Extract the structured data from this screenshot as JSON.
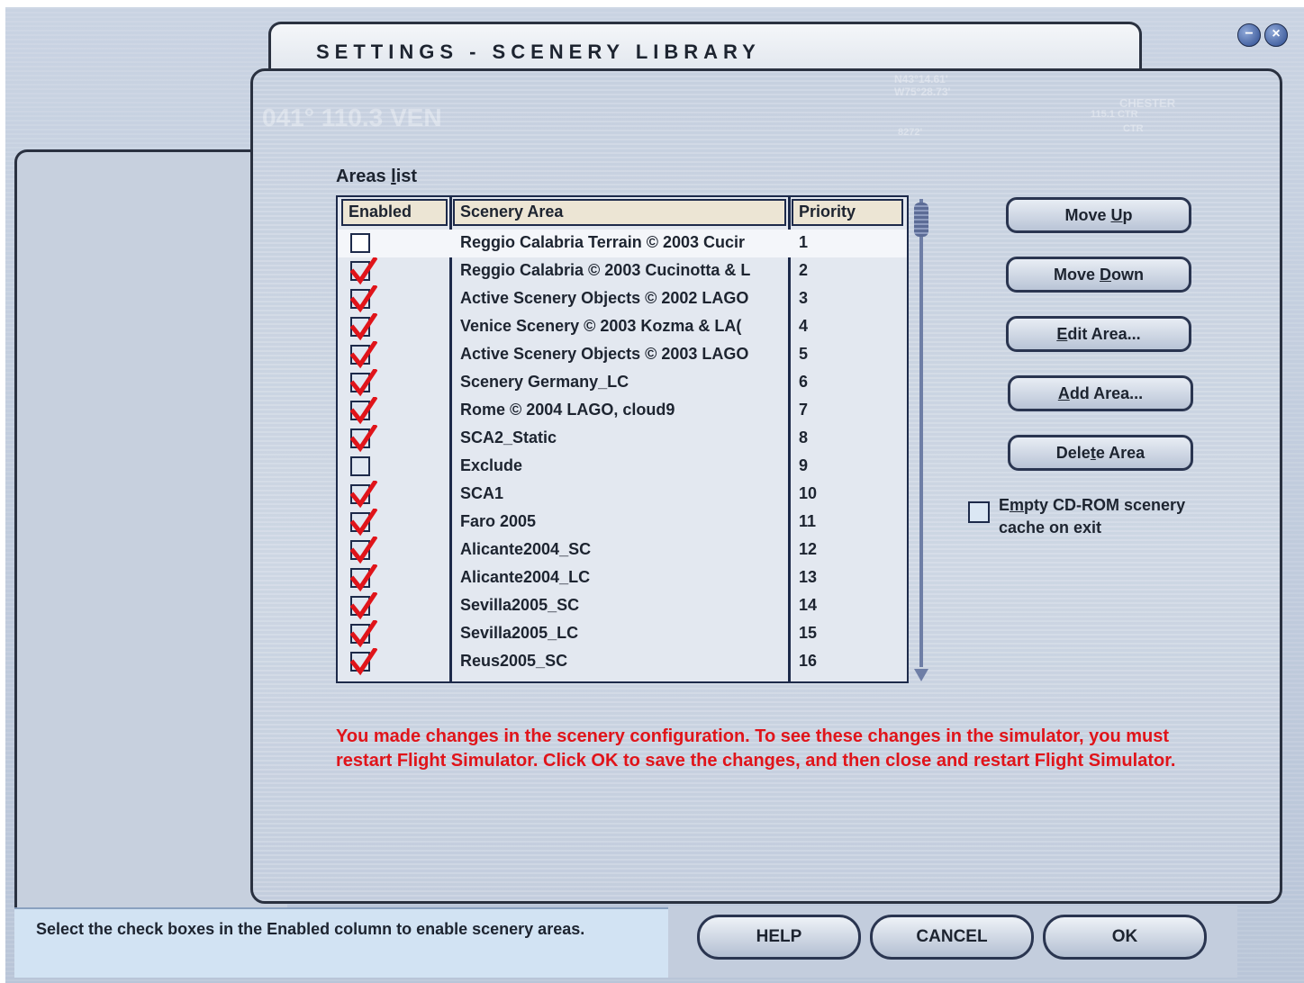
{
  "window": {
    "title": "SETTINGS - SCENERY LIBRARY",
    "minimize_glyph": "−",
    "close_glyph": "×"
  },
  "areas_list": {
    "label_prefix": "Areas ",
    "label_underlined": "l",
    "label_suffix": "ist",
    "headers": {
      "enabled": "Enabled",
      "area": "Scenery Area",
      "priority": "Priority"
    },
    "rows": [
      {
        "enabled": false,
        "area": "Reggio Calabria Terrain © 2003 Cucir",
        "priority": "1",
        "selected": true
      },
      {
        "enabled": true,
        "area": "Reggio Calabria © 2003 Cucinotta & L",
        "priority": "2"
      },
      {
        "enabled": true,
        "area": "Active Scenery Objects © 2002 LAGO",
        "priority": "3"
      },
      {
        "enabled": true,
        "area": "Venice Scenery © 2003 Kozma & LA(",
        "priority": "4"
      },
      {
        "enabled": true,
        "area": "Active Scenery Objects © 2003 LAGO",
        "priority": "5"
      },
      {
        "enabled": true,
        "area": "Scenery Germany_LC",
        "priority": "6"
      },
      {
        "enabled": true,
        "area": "Rome © 2004 LAGO, cloud9",
        "priority": "7"
      },
      {
        "enabled": true,
        "area": "SCA2_Static",
        "priority": "8"
      },
      {
        "enabled": false,
        "area": "Exclude",
        "priority": "9"
      },
      {
        "enabled": true,
        "area": "SCA1",
        "priority": "10"
      },
      {
        "enabled": true,
        "area": "Faro 2005",
        "priority": "11"
      },
      {
        "enabled": true,
        "area": "Alicante2004_SC",
        "priority": "12"
      },
      {
        "enabled": true,
        "area": "Alicante2004_LC",
        "priority": "13"
      },
      {
        "enabled": true,
        "area": "Sevilla2005_SC",
        "priority": "14"
      },
      {
        "enabled": true,
        "area": "Sevilla2005_LC",
        "priority": "15"
      },
      {
        "enabled": true,
        "area": "Reus2005_SC",
        "priority": "16"
      }
    ]
  },
  "buttons": {
    "move_up": {
      "pre": "Move ",
      "u": "U",
      "post": "p"
    },
    "move_down": {
      "pre": "Move ",
      "u": "D",
      "post": "own"
    },
    "edit_area": {
      "pre": "",
      "u": "E",
      "post": "dit Area..."
    },
    "add_area": {
      "pre": "",
      "u": "A",
      "post": "dd Area..."
    },
    "delete_area": {
      "pre": "Dele",
      "u": "t",
      "post": "e Area"
    }
  },
  "cdrom_cache": {
    "checked": false,
    "line1_pre": "E",
    "line1_u": "m",
    "line1_post": "pty CD-ROM scenery",
    "line2": "cache on exit"
  },
  "warning": "You made changes in the scenery configuration. To see these changes in the simulator, you must restart Flight Simulator. Click OK to save the changes, and then close and restart Flight Simulator.",
  "status": "Select the check boxes in the Enabled column to enable scenery areas.",
  "footer": {
    "help": "HELP",
    "cancel": "CANCEL",
    "ok": "OK"
  },
  "background_watermark": {
    "frequency": "041° 110.3 VEN",
    "coords_1": "N43°14.61'",
    "coords_2": "W75°28.73'",
    "station_name": "CHESTER",
    "station_info": "115.1 CTR",
    "station_code": "CTR",
    "elevation": "8272'"
  },
  "colors": {
    "warning": "#e0141a",
    "checkmark": "#e0141a",
    "frame": "#2a3140"
  }
}
